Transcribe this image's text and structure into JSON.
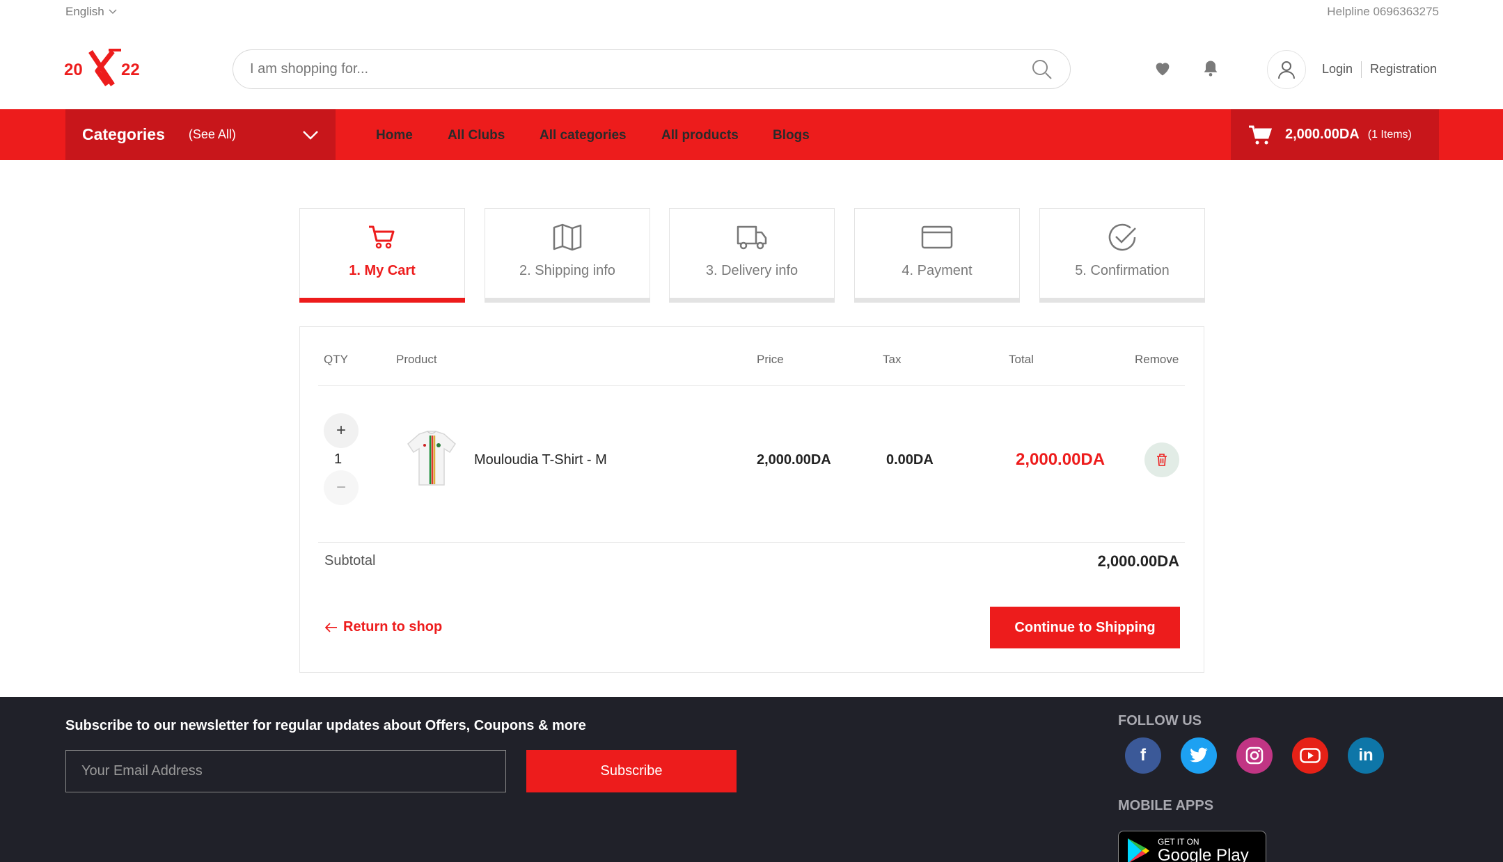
{
  "topbar": {
    "language": "English",
    "helpline": "Helpline 0696363275"
  },
  "header": {
    "search_placeholder": "I am shopping for...",
    "login": "Login",
    "registration": "Registration"
  },
  "nav": {
    "categories_title": "Categories",
    "categories_see_all": "(See All)",
    "links": [
      "Home",
      "All Clubs",
      "All categories",
      "All products",
      "Blogs"
    ],
    "cart_amount": "2,000.00DA",
    "cart_count": "(1 Items)"
  },
  "steps": [
    {
      "label": "1. My Cart",
      "icon": "cart-icon",
      "active": true
    },
    {
      "label": "2. Shipping info",
      "icon": "map-icon",
      "active": false
    },
    {
      "label": "3. Delivery info",
      "icon": "truck-icon",
      "active": false
    },
    {
      "label": "4. Payment",
      "icon": "card-icon",
      "active": false
    },
    {
      "label": "5. Confirmation",
      "icon": "check-circle-icon",
      "active": false
    }
  ],
  "cart": {
    "headers": {
      "qty": "QTY",
      "product": "Product",
      "price": "Price",
      "tax": "Tax",
      "total": "Total",
      "remove": "Remove"
    },
    "items": [
      {
        "qty": "1",
        "name": "Mouloudia T-Shirt - M",
        "price": "2,000.00DA",
        "tax": "0.00DA",
        "total": "2,000.00DA"
      }
    ],
    "subtotal_label": "Subtotal",
    "subtotal_value": "2,000.00DA",
    "return_label": "Return to shop",
    "continue_label": "Continue to Shipping"
  },
  "footer": {
    "newsletter_title": "Subscribe to our newsletter for regular updates about Offers, Coupons & more",
    "email_placeholder": "Your Email Address",
    "subscribe_label": "Subscribe",
    "follow_title": "FOLLOW US",
    "mobile_title": "MOBILE APPS",
    "social": [
      "facebook-icon",
      "twitter-icon",
      "instagram-icon",
      "youtube-icon",
      "linkedin-icon"
    ],
    "gplay_small": "GET IT ON",
    "gplay_big": "Google Play"
  },
  "colors": {
    "brand_red": "#ed1c1c",
    "brand_dark_red": "#c8161b",
    "footer_bg": "#202129"
  }
}
